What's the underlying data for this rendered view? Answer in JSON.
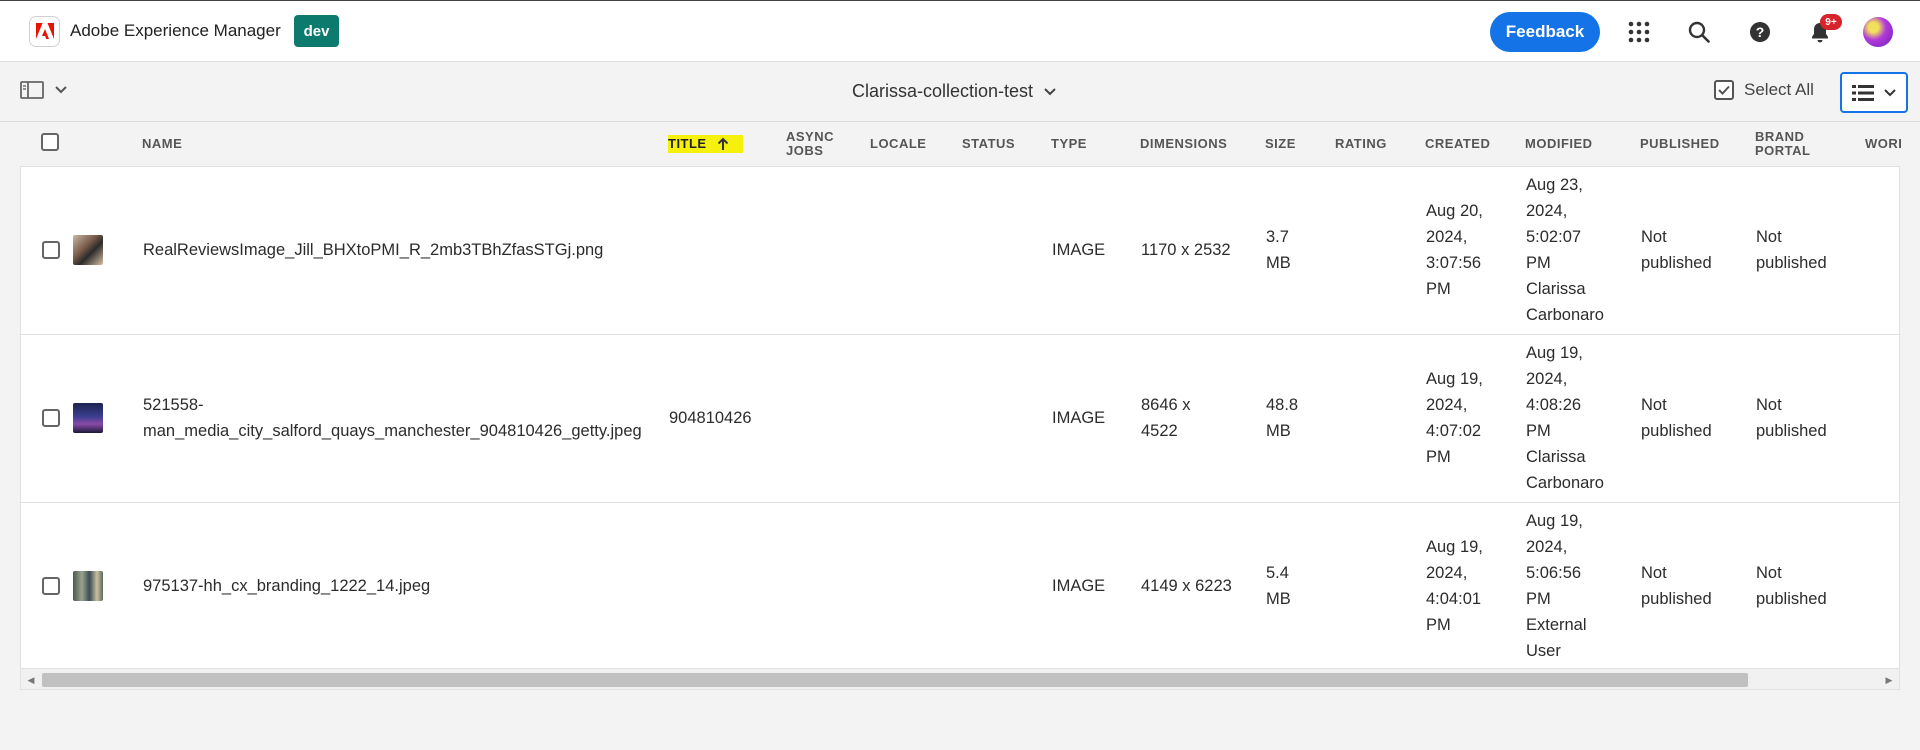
{
  "header": {
    "app_title": "Adobe Experience Manager",
    "env_badge": "dev",
    "feedback_label": "Feedback",
    "notification_count": "9+",
    "brand_color": "#1473e6",
    "env_color": "#0d7a6e"
  },
  "actionbar": {
    "collection_title": "Clarissa-collection-test",
    "select_all_label": "Select All"
  },
  "table": {
    "columns": {
      "name": "NAME",
      "title": "TITLE",
      "async_jobs_1": "ASYNC",
      "async_jobs_2": "JOBS",
      "locale": "LOCALE",
      "status": "STATUS",
      "type": "TYPE",
      "dimensions": "DIMENSIONS",
      "size": "SIZE",
      "rating": "RATING",
      "created": "CREATED",
      "modified": "MODIFIED",
      "published": "PUBLISHED",
      "brand_portal_1": "BRAND",
      "brand_portal_2": "PORTAL",
      "workflow": "WORI"
    },
    "sorted_column": "TITLE",
    "sort_direction": "ascending",
    "rows": [
      {
        "name": "RealReviewsImage_Jill_BHXtoPMI_R_2mb3TBhZfasSTGj.png",
        "title": "",
        "type": "IMAGE",
        "dimensions": "1170 x 2532",
        "size_1": "3.7",
        "size_2": "MB",
        "created": [
          "Aug 20,",
          "2024,",
          "3:07:56",
          "PM"
        ],
        "modified": [
          "Aug 23,",
          "2024,",
          "5:02:07",
          "PM",
          "Clarissa",
          "Carbonaro"
        ],
        "published": [
          "Not",
          "published"
        ],
        "brand_portal": [
          "Not",
          "published"
        ]
      },
      {
        "name_1": "521558-",
        "name_2": "man_media_city_salford_quays_manchester_904810426_getty.jpeg",
        "title": "904810426",
        "type": "IMAGE",
        "dimensions_1": "8646 x",
        "dimensions_2": "4522",
        "size_1": "48.8",
        "size_2": "MB",
        "created": [
          "Aug 19,",
          "2024,",
          "4:07:02",
          "PM"
        ],
        "modified": [
          "Aug 19,",
          "2024,",
          "4:08:26",
          "PM",
          "Clarissa",
          "Carbonaro"
        ],
        "published": [
          "Not",
          "published"
        ],
        "brand_portal": [
          "Not",
          "published"
        ]
      },
      {
        "name": "975137-hh_cx_branding_1222_14.jpeg",
        "title": "",
        "type": "IMAGE",
        "dimensions": "4149 x 6223",
        "size_1": "5.4",
        "size_2": "MB",
        "created": [
          "Aug 19,",
          "2024,",
          "4:04:01",
          "PM"
        ],
        "modified": [
          "Aug 19,",
          "2024,",
          "5:06:56",
          "PM",
          "External",
          "User"
        ],
        "published": [
          "Not",
          "published"
        ],
        "brand_portal": [
          "Not",
          "published"
        ]
      }
    ]
  },
  "scrollbar": {
    "scroll_position_fraction": 0.0,
    "visible_fraction": 0.91
  }
}
